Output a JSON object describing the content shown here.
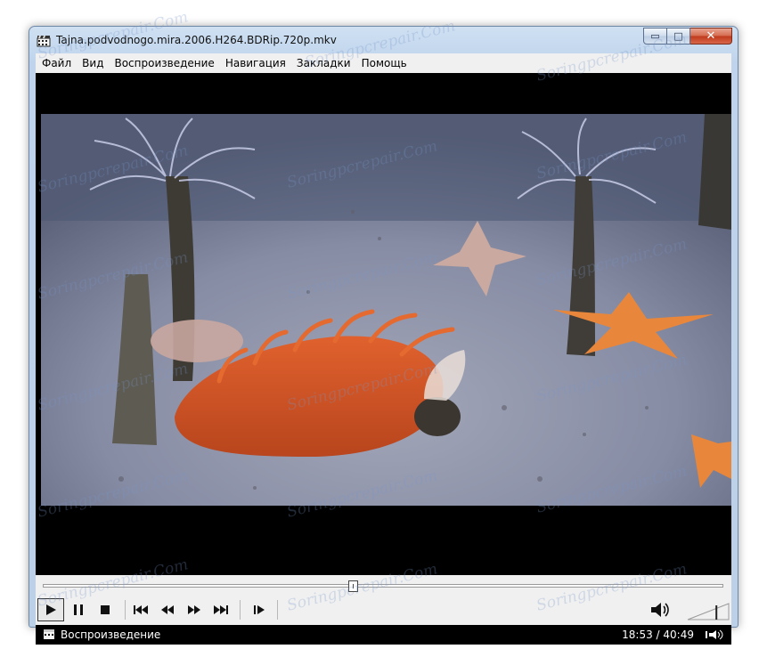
{
  "window": {
    "title": "Tajna.podvodnogo.mira.2006.H264.BDRip.720p.mkv",
    "caption": {
      "minimize": "▭",
      "maximize": "□",
      "close": "✕"
    }
  },
  "menu": {
    "items": [
      "Файл",
      "Вид",
      "Воспроизведение",
      "Навигация",
      "Закладки",
      "Помощь"
    ]
  },
  "playback": {
    "progress": 0.456,
    "volume": 0.7
  },
  "status": {
    "text": "Воспроизведение",
    "time": "18:53 / 40:49"
  },
  "watermark": {
    "text": "Soringpcrepair.Com"
  },
  "colors": {
    "titlebar": "#c4d7ee",
    "status_bg": "#000000",
    "close_button": "#c8452a"
  }
}
